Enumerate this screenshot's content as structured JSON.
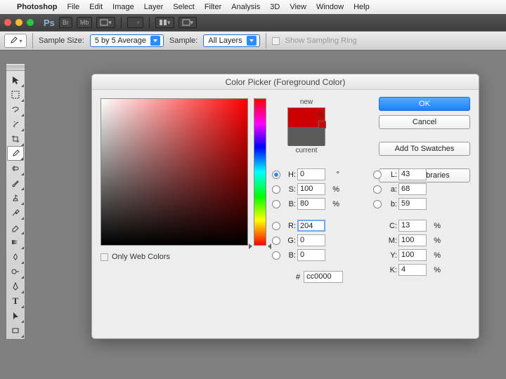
{
  "menubar": [
    "Photoshop",
    "File",
    "Edit",
    "Image",
    "Layer",
    "Select",
    "Filter",
    "Analysis",
    "3D",
    "View",
    "Window",
    "Help"
  ],
  "appbar": {
    "br": "Br",
    "mb": "Mb"
  },
  "optbar": {
    "sample_size_label": "Sample Size:",
    "sample_size_value": "5 by 5 Average",
    "sample_label": "Sample:",
    "sample_value": "All Layers",
    "show_ring": "Show Sampling Ring"
  },
  "dialog": {
    "title": "Color Picker (Foreground Color)",
    "new_label": "new",
    "current_label": "current",
    "ok": "OK",
    "cancel": "Cancel",
    "add_swatches": "Add To Swatches",
    "libraries": "Color Libraries",
    "only_web": "Only Web Colors",
    "hsb": {
      "H": "0",
      "S": "100",
      "B": "80"
    },
    "rgb": {
      "R": "204",
      "G": "0",
      "B": "0"
    },
    "lab": {
      "L": "43",
      "a": "68",
      "b": "59"
    },
    "cmyk": {
      "C": "13",
      "M": "100",
      "Y": "100",
      "K": "4"
    },
    "deg": "°",
    "pct": "%",
    "hash": "#",
    "hex": "cc0000",
    "labels": {
      "H": "H:",
      "S": "S:",
      "Bv": "B:",
      "R": "R:",
      "G": "G:",
      "Bb": "B:",
      "L": "L:",
      "a": "a:",
      "b": "b:",
      "C": "C:",
      "M": "M:",
      "Y": "Y:",
      "K": "K:"
    }
  }
}
